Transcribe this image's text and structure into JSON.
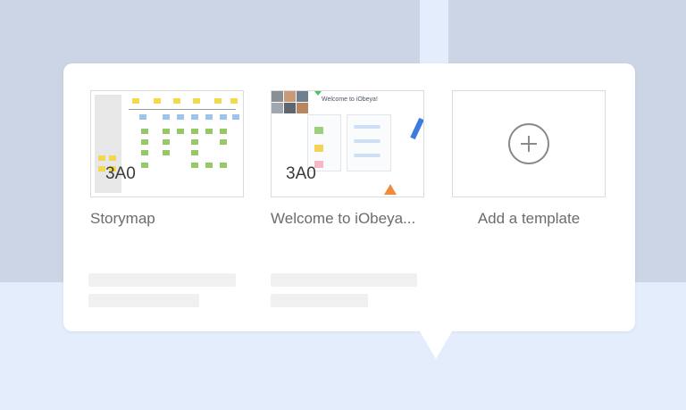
{
  "templates": [
    {
      "title": "Storymap",
      "overlay_code": "3A0",
      "thumbnail": "storymap-board-preview"
    },
    {
      "title": "Welcome to iObeya...",
      "overlay_code": "3A0",
      "thumbnail": "welcome-board-preview",
      "thumb_heading": "Welcome to iObeya!"
    }
  ],
  "add_template": {
    "label": "Add a template",
    "icon": "plus-circle-icon"
  },
  "colors": {
    "background": "#ccd5e5",
    "page": "#e4edfb",
    "card_border": "#dcdcdc",
    "title": "#6c6c6c",
    "skeleton": "#f0f0f0"
  }
}
